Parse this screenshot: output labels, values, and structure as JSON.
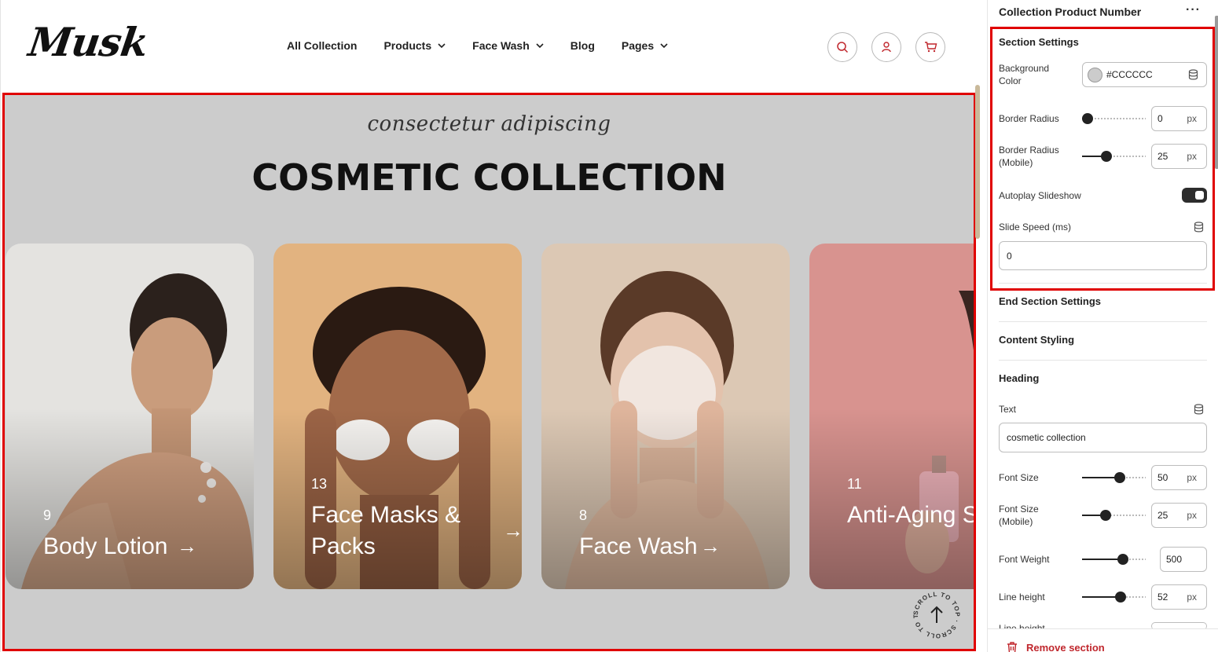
{
  "site": {
    "logo": "Musk",
    "nav": [
      {
        "label": "All Collection",
        "dropdown": false
      },
      {
        "label": "Products",
        "dropdown": true
      },
      {
        "label": "Face Wash",
        "dropdown": true
      },
      {
        "label": "Blog",
        "dropdown": false
      },
      {
        "label": "Pages",
        "dropdown": true
      }
    ],
    "header_icons": [
      "search-icon",
      "user-icon",
      "cart-icon"
    ]
  },
  "section": {
    "background": "#CCCCCC",
    "subheading": "consectetur adipiscing",
    "heading": "COSMETIC COLLECTION",
    "cards": [
      {
        "count": "9",
        "name": "Body Lotion",
        "arrow": "→",
        "bg": "#e4e3e0"
      },
      {
        "count": "13",
        "name": "Face Masks & Packs",
        "arrow": "→",
        "bg": "#e2b380"
      },
      {
        "count": "8",
        "name": "Face Wash",
        "arrow": "→",
        "bg": "#dcc8b4"
      },
      {
        "count": "11",
        "name": "Anti-Aging Serum",
        "arrow": "→",
        "bg": "#d8938f"
      }
    ],
    "scroll_top_text": "SCROLL TO TOP · SCROLL TO TOP ·"
  },
  "panel": {
    "title": "Collection Product Number",
    "more": "···",
    "section_settings": "Section Settings",
    "background_color_label": "Background Color",
    "background_color_value": "#CCCCCC",
    "border_radius_label": "Border Radius",
    "border_radius_value": "0",
    "border_radius_level": 0,
    "border_radius_mobile_label": "Border Radius (Mobile)",
    "border_radius_mobile_value": "25",
    "border_radius_mobile_level": 0.3,
    "autoplay_label": "Autoplay Slideshow",
    "autoplay_on": true,
    "slide_speed_label": "Slide Speed (ms)",
    "slide_speed_value": "0",
    "end_section_settings": "End Section Settings",
    "content_styling": "Content Styling",
    "heading_group": "Heading",
    "text_label": "Text",
    "text_value": "cosmetic collection",
    "font_size_label": "Font Size",
    "font_size_value": "50",
    "font_size_level": 0.5,
    "font_size_mobile_label": "Font Size (Mobile)",
    "font_size_mobile_value": "25",
    "font_size_mobile_level": 0.28,
    "font_weight_label": "Font Weight",
    "font_weight_value": "500",
    "font_weight_level": 0.56,
    "line_height_label": "Line height",
    "line_height_value": "52",
    "line_height_level": 0.52,
    "line_height_2_label": "Line height",
    "unit": "px",
    "remove_label": "Remove section"
  }
}
